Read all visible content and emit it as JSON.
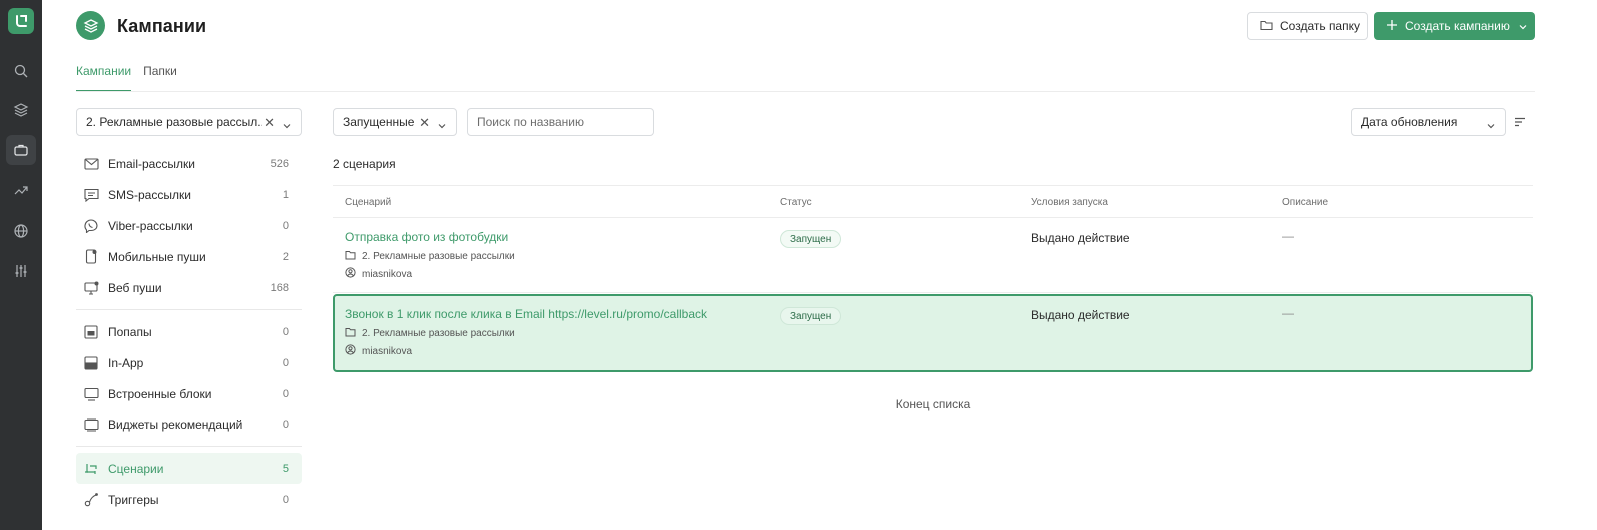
{
  "header": {
    "title": "Кампании",
    "create_folder_label": "Создать папку",
    "create_campaign_label": "Создать кампанию"
  },
  "tabs": [
    {
      "label": "Кампании",
      "active": true
    },
    {
      "label": "Папки",
      "active": false
    }
  ],
  "folder_select": {
    "value": "2. Рекламные разовые рассыл..."
  },
  "nav": {
    "group1": [
      {
        "label": "Email-рассылки",
        "count": "526",
        "icon": "mail-icon"
      },
      {
        "label": "SMS-рассылки",
        "count": "1",
        "icon": "sms-icon"
      },
      {
        "label": "Viber-рассылки",
        "count": "0",
        "icon": "viber-icon"
      },
      {
        "label": "Мобильные пуши",
        "count": "2",
        "icon": "mobile-icon"
      },
      {
        "label": "Веб пуши",
        "count": "168",
        "icon": "monitor-icon"
      }
    ],
    "group2": [
      {
        "label": "Попапы",
        "count": "0",
        "icon": "popup-icon"
      },
      {
        "label": "In-App",
        "count": "0",
        "icon": "inapp-icon"
      },
      {
        "label": "Встроенные блоки",
        "count": "0",
        "icon": "embed-icon"
      },
      {
        "label": "Виджеты рекомендаций",
        "count": "0",
        "icon": "widget-icon"
      }
    ],
    "group3": [
      {
        "label": "Сценарии",
        "count": "5",
        "icon": "scenario-icon",
        "active": true
      },
      {
        "label": "Триггеры",
        "count": "0",
        "icon": "trigger-icon"
      }
    ]
  },
  "filters": {
    "status_value": "Запущенные",
    "search_placeholder": "Поиск по названию",
    "sort_value": "Дата обновления"
  },
  "count_text": "2 сценария",
  "table": {
    "columns": [
      "Сценарий",
      "Статус",
      "Условия запуска",
      "Описание"
    ],
    "rows": [
      {
        "name": "Отправка фото из фотобудки",
        "folder": "2. Рекламные разовые рассылки",
        "author": "miasnikova",
        "status": "Запущен",
        "condition": "Выдано действие",
        "description": "—",
        "selected": false
      },
      {
        "name": "Звонок в 1 клик после клика в Email https://level.ru/promo/callback",
        "folder": "2. Рекламные разовые рассылки",
        "author": "miasnikova",
        "status": "Запущен",
        "condition": "Выдано действие",
        "description": "—",
        "selected": true
      }
    ]
  },
  "end_text": "Конец списка",
  "colors": {
    "accent": "#3e9a6a",
    "rail": "#2f3133",
    "selected_bg": "#dff3e6"
  }
}
